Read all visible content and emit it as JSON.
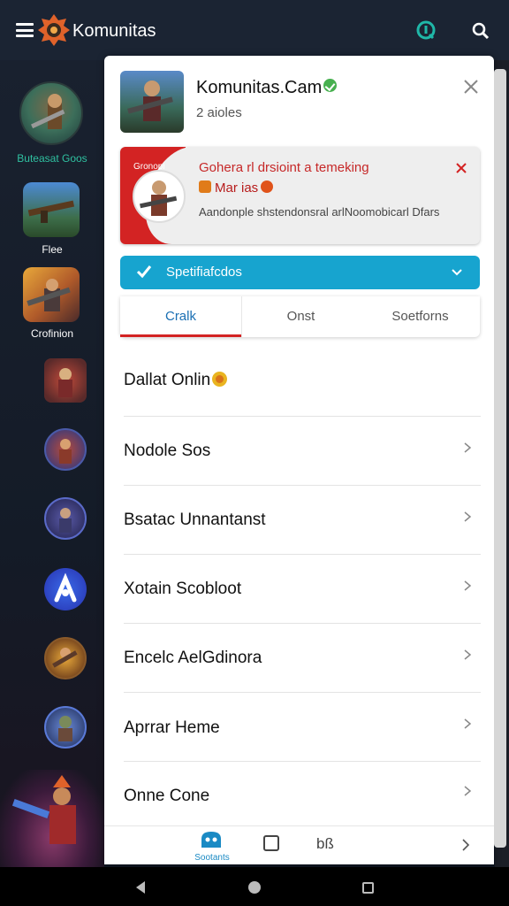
{
  "appbar": {
    "title": "Komunitas",
    "icons": [
      "menu-icon",
      "logo-icon",
      "q-icon",
      "search-icon"
    ]
  },
  "rail": {
    "items": [
      {
        "label": "Buteasat Goos"
      },
      {
        "label": "Flee"
      },
      {
        "label": "Crofinion"
      },
      {
        "label": ""
      },
      {
        "label": ""
      },
      {
        "label": ""
      },
      {
        "label": ""
      },
      {
        "label": ""
      },
      {
        "label": ""
      }
    ]
  },
  "panel": {
    "title": "Komunitas.Cam",
    "subtitle": "2 aioles",
    "alert": {
      "tag": "Gronopi",
      "title": "Gohera rl drsioint a temeking",
      "line2": "Mar ias",
      "body": "Aandonple shstendonsral arlNoomobicarl Dfars"
    },
    "accordion": {
      "label": "Spetifiafcdos"
    },
    "tabs": [
      {
        "label": "Cralk",
        "active": true
      },
      {
        "label": "Onst",
        "active": false
      },
      {
        "label": "Soetforns",
        "active": false
      }
    ],
    "list": [
      {
        "label": "Dallat Onlin"
      },
      {
        "label": "Nodole Sos"
      },
      {
        "label": "Bsatac Unnantanst"
      },
      {
        "label": "Xotain Scobloot"
      },
      {
        "label": "Encelc AelGdinora"
      },
      {
        "label": "Aprrar Heme"
      },
      {
        "label": "Onne Cone"
      }
    ],
    "bottom": {
      "home_label": "Sootants",
      "text": "bß"
    }
  },
  "colors": {
    "appbar": "#1b2433",
    "accent_red": "#d32323",
    "accent_blue": "#17a4cf",
    "verified_green": "#47b04f",
    "q_icon_teal": "#1fb7a8"
  }
}
